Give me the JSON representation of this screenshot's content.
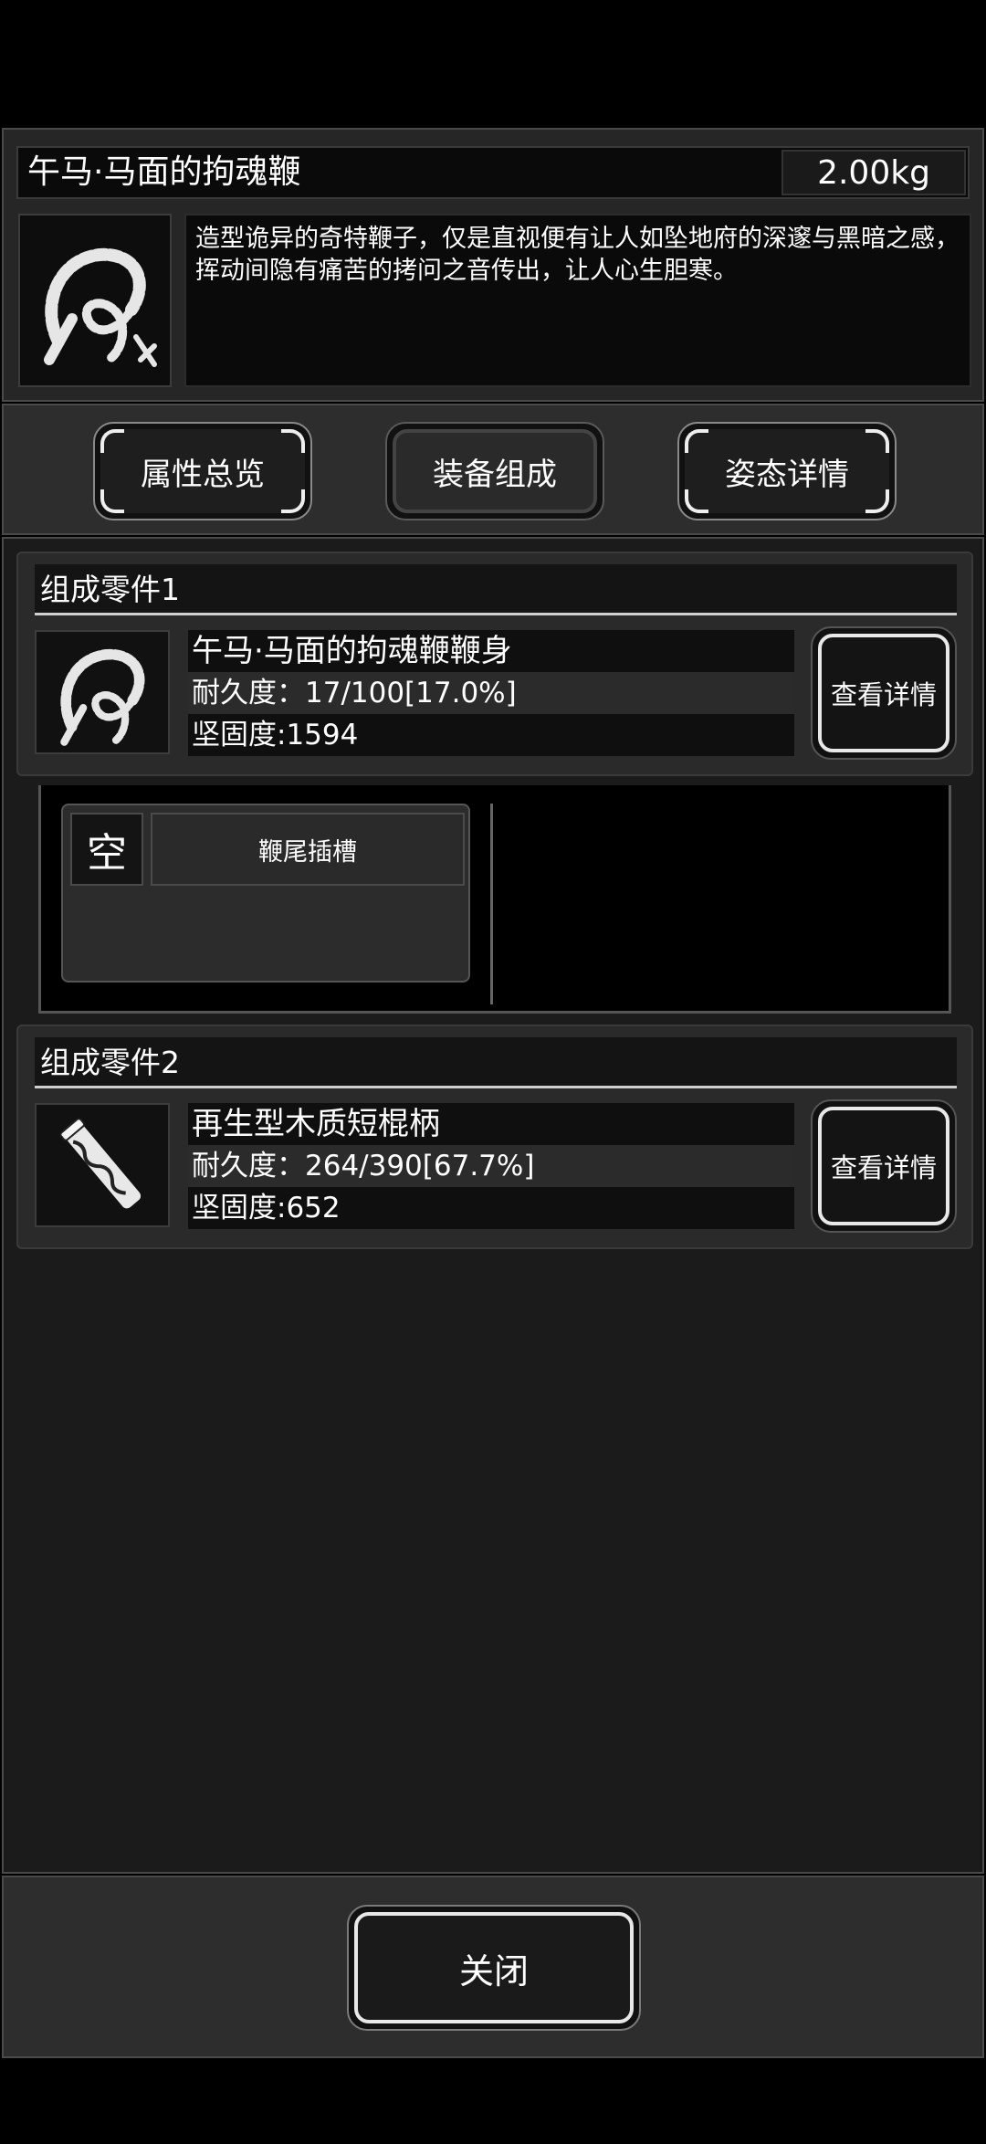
{
  "item": {
    "name": "午马·马面的拘魂鞭",
    "weight": "2.00kg",
    "description": "造型诡异的奇特鞭子，仅是直视便有让人如坠地府的深邃与黑暗之感，挥动间隐有痛苦的拷问之音传出，让人心生胆寒。",
    "icon": "whip-icon"
  },
  "tabs": [
    {
      "label": "属性总览",
      "active": false
    },
    {
      "label": "装备组成",
      "active": true
    },
    {
      "label": "姿态详情",
      "active": false
    }
  ],
  "components": [
    {
      "header": "组成零件1",
      "name": "午马·马面的拘魂鞭鞭身",
      "durability": "耐久度：17/100[17.0%]",
      "hardness": "坚固度:1594",
      "detail_label": "查看详情",
      "icon": "whip-body-icon"
    },
    {
      "header": "组成零件2",
      "name": "再生型木质短棍柄",
      "durability": "耐久度：264/390[67.7%]",
      "hardness": "坚固度:652",
      "detail_label": "查看详情",
      "icon": "stick-handle-icon"
    }
  ],
  "slot": {
    "status": "空",
    "label": "鞭尾插槽"
  },
  "close_label": "关闭",
  "colors": {
    "background": "#000000",
    "panel": "#1b1b1b",
    "border": "#4a4a4a",
    "text": "#ffffff"
  }
}
